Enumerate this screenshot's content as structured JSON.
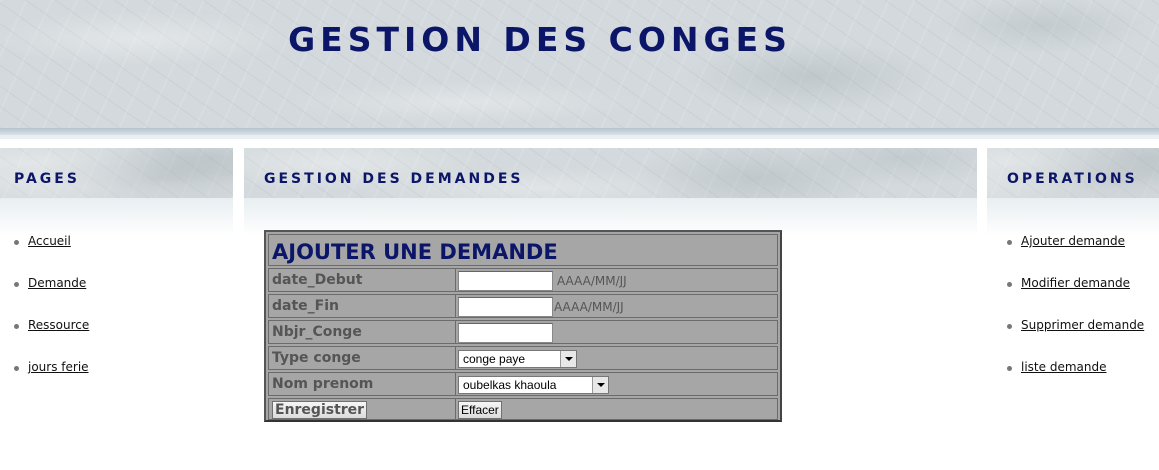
{
  "header": {
    "title": "GESTION DES CONGES"
  },
  "left": {
    "title": "PAGES",
    "items": [
      {
        "label": "Accueil"
      },
      {
        "label": "Demande"
      },
      {
        "label": "Ressource"
      },
      {
        "label": "jours ferie"
      }
    ]
  },
  "center": {
    "title": "GESTION DES DEMANDES"
  },
  "right": {
    "title": "OPERATIONS",
    "items": [
      {
        "label": "Ajouter demande"
      },
      {
        "label": "Modifier demande"
      },
      {
        "label": "Supprimer demande"
      },
      {
        "label": "liste demande"
      }
    ]
  },
  "form": {
    "title": "AJOUTER UNE DEMANDE",
    "fields": {
      "date_debut": {
        "label": "date_Debut",
        "value": "",
        "hint": "AAAA/MM/JJ"
      },
      "date_fin": {
        "label": "date_Fin",
        "value": "",
        "hint": "AAAA/MM/JJ"
      },
      "nbjr": {
        "label": "Nbjr_Conge",
        "value": ""
      },
      "type": {
        "label": "Type conge",
        "selected": "conge paye"
      },
      "nom": {
        "label": "Nom prenom",
        "selected": "oubelkas khaoula"
      }
    },
    "buttons": {
      "save": "Enregistrer",
      "clear": "Effacer"
    }
  }
}
